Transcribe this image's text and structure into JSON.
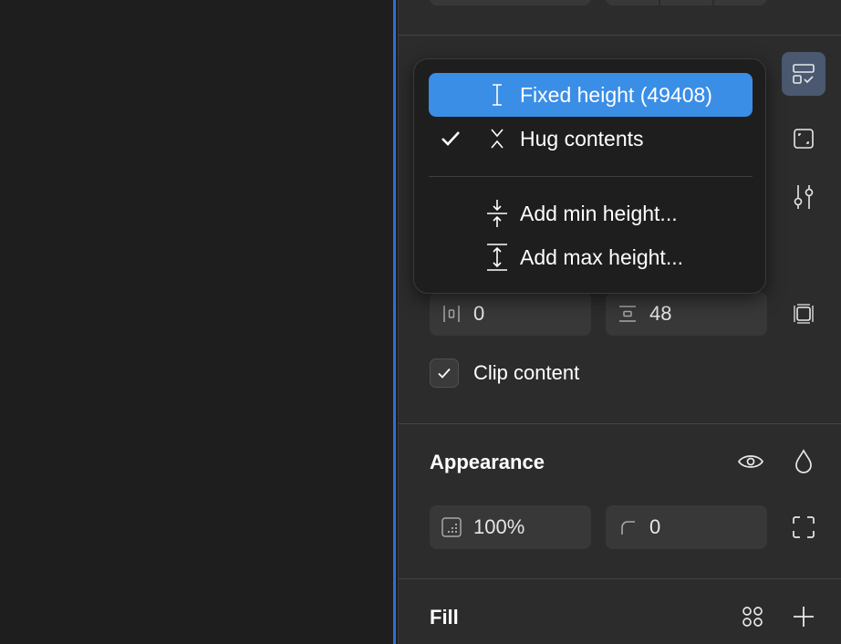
{
  "menu": {
    "items": [
      {
        "label": "Fixed height (49408)",
        "icon": "fixed-height-icon",
        "highlighted": true,
        "checked": false
      },
      {
        "label": "Hug contents",
        "icon": "hug-contents-icon",
        "highlighted": false,
        "checked": true
      },
      {
        "label": "Add min height...",
        "icon": "min-height-icon",
        "highlighted": false,
        "checked": false
      },
      {
        "label": "Add max height...",
        "icon": "max-height-icon",
        "highlighted": false,
        "checked": false
      }
    ]
  },
  "auto_layout": {
    "gap": "0",
    "padding": "48",
    "clip_content_label": "Clip content",
    "clip_content_checked": true
  },
  "appearance": {
    "title": "Appearance",
    "opacity": "100%",
    "corner_radius": "0"
  },
  "fill": {
    "title": "Fill"
  },
  "colors": {
    "highlight": "#3a8ee6",
    "selection": "#2e6fd8",
    "panel": "#2c2c2c",
    "field": "#383838"
  }
}
